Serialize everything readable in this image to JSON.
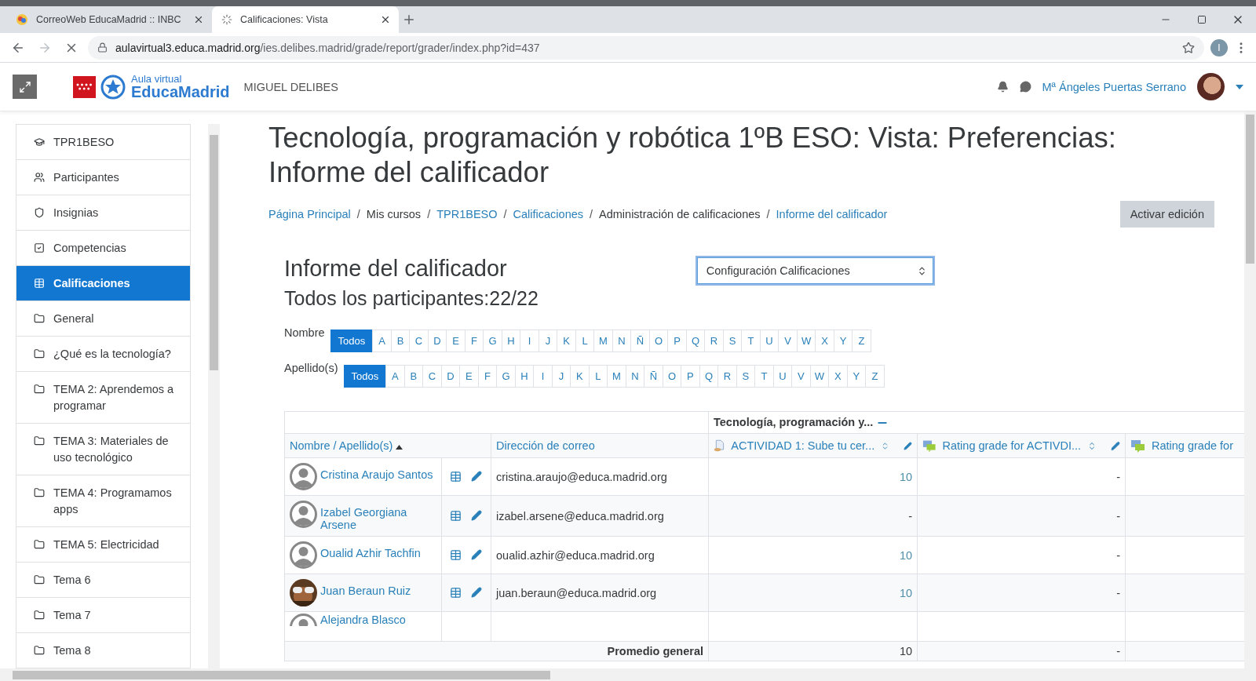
{
  "browser": {
    "tabs": [
      {
        "title": "CorreoWeb EducaMadrid :: INBC",
        "selected": false,
        "loading": false
      },
      {
        "title": "Calificaciones: Vista",
        "selected": true,
        "loading": true
      }
    ],
    "url": {
      "host": "aulavirtual3.educa.madrid.org",
      "path": "/ies.delibes.madrid/grade/report/grader/index.php?id=437"
    },
    "profile_initial": "I"
  },
  "header": {
    "logo": {
      "small": "Aula virtual",
      "big": "EducaMadrid"
    },
    "site_name": "MIGUEL DELIBES",
    "user_name": "Mª Ángeles Puertas Serrano"
  },
  "sidebar": {
    "items": [
      {
        "label": "TPR1BESO",
        "kind": "course",
        "selected": false
      },
      {
        "label": "Participantes",
        "kind": "participants",
        "selected": false
      },
      {
        "label": "Insignias",
        "kind": "badges",
        "selected": false
      },
      {
        "label": "Competencias",
        "kind": "competencies",
        "selected": false
      },
      {
        "label": "Calificaciones",
        "kind": "grades",
        "selected": true
      },
      {
        "label": "General",
        "kind": "section",
        "selected": false
      },
      {
        "label": "¿Qué es la tecnología?",
        "kind": "section",
        "selected": false
      },
      {
        "label": "TEMA 2: Aprendemos a programar",
        "kind": "section",
        "selected": false
      },
      {
        "label": "TEMA 3: Materiales de uso tecnológico",
        "kind": "section",
        "selected": false
      },
      {
        "label": "TEMA 4: Programamos apps",
        "kind": "section",
        "selected": false
      },
      {
        "label": "TEMA 5: Electricidad",
        "kind": "section",
        "selected": false
      },
      {
        "label": "Tema 6",
        "kind": "section",
        "selected": false
      },
      {
        "label": "Tema 7",
        "kind": "section",
        "selected": false
      },
      {
        "label": "Tema 8",
        "kind": "section",
        "selected": false
      }
    ]
  },
  "page": {
    "title": "Tecnología, programación y robótica 1ºB ESO: Vista: Preferencias: Informe del calificador",
    "breadcrumb": [
      {
        "label": "Página Principal",
        "link": true
      },
      {
        "separator": "/",
        "label": "Mis cursos",
        "link": false
      },
      {
        "separator": "/",
        "label": "TPR1BESO",
        "link": true
      },
      {
        "separator": "/",
        "label": "Calificaciones",
        "link": true
      },
      {
        "separator": "/",
        "label": "Administración de calificaciones",
        "link": false
      },
      {
        "separator": "/",
        "label": "Informe del calificador",
        "link": true
      }
    ],
    "edit_button": "Activar edición",
    "report_title": "Informe del calificador",
    "participants": "Todos los participantes:22/22",
    "select": {
      "value": "Configuración Calificaciones"
    },
    "filters": [
      {
        "label": "Nombre",
        "options": [
          {
            "label": "Todos",
            "selected": true
          },
          {
            "label": "A",
            "selected": false
          },
          {
            "label": "B",
            "selected": false
          },
          {
            "label": "C",
            "selected": false
          },
          {
            "label": "D",
            "selected": false
          },
          {
            "label": "E",
            "selected": false
          },
          {
            "label": "F",
            "selected": false
          },
          {
            "label": "G",
            "selected": false
          },
          {
            "label": "H",
            "selected": false
          },
          {
            "label": "I",
            "selected": false
          },
          {
            "label": "J",
            "selected": false
          },
          {
            "label": "K",
            "selected": false
          },
          {
            "label": "L",
            "selected": false
          },
          {
            "label": "M",
            "selected": false
          },
          {
            "label": "N",
            "selected": false
          },
          {
            "label": "Ñ",
            "selected": false
          },
          {
            "label": "O",
            "selected": false
          },
          {
            "label": "P",
            "selected": false
          },
          {
            "label": "Q",
            "selected": false
          },
          {
            "label": "R",
            "selected": false
          },
          {
            "label": "S",
            "selected": false
          },
          {
            "label": "T",
            "selected": false
          },
          {
            "label": "U",
            "selected": false
          },
          {
            "label": "V",
            "selected": false
          },
          {
            "label": "W",
            "selected": false
          },
          {
            "label": "X",
            "selected": false
          },
          {
            "label": "Y",
            "selected": false
          },
          {
            "label": "Z",
            "selected": false
          }
        ]
      },
      {
        "label": "Apellido(s)",
        "options": [
          {
            "label": "Todos",
            "selected": true
          },
          {
            "label": "A",
            "selected": false
          },
          {
            "label": "B",
            "selected": false
          },
          {
            "label": "C",
            "selected": false
          },
          {
            "label": "D",
            "selected": false
          },
          {
            "label": "E",
            "selected": false
          },
          {
            "label": "F",
            "selected": false
          },
          {
            "label": "G",
            "selected": false
          },
          {
            "label": "H",
            "selected": false
          },
          {
            "label": "I",
            "selected": false
          },
          {
            "label": "J",
            "selected": false
          },
          {
            "label": "K",
            "selected": false
          },
          {
            "label": "L",
            "selected": false
          },
          {
            "label": "M",
            "selected": false
          },
          {
            "label": "N",
            "selected": false
          },
          {
            "label": "Ñ",
            "selected": false
          },
          {
            "label": "O",
            "selected": false
          },
          {
            "label": "P",
            "selected": false
          },
          {
            "label": "Q",
            "selected": false
          },
          {
            "label": "R",
            "selected": false
          },
          {
            "label": "S",
            "selected": false
          },
          {
            "label": "T",
            "selected": false
          },
          {
            "label": "U",
            "selected": false
          },
          {
            "label": "V",
            "selected": false
          },
          {
            "label": "W",
            "selected": false
          },
          {
            "label": "X",
            "selected": false
          },
          {
            "label": "Y",
            "selected": false
          },
          {
            "label": "Z",
            "selected": false
          }
        ]
      }
    ],
    "table": {
      "category": "Tecnología, programación y...",
      "columns": {
        "name": "Nombre / Apellido(s)",
        "email": "Dirección de correo",
        "items": [
          {
            "label": "ACTIVIDAD 1: Sube tu cer...",
            "kind": "assignment"
          },
          {
            "label": "Rating grade for ACTIVDI...",
            "kind": "forum"
          },
          {
            "label": "Rating grade for",
            "kind": "forum"
          }
        ]
      },
      "rows": [
        {
          "name": "Cristina Araujo Santos",
          "kind": "default",
          "email": "cristina.araujo@educa.madrid.org",
          "grades": [
            {
              "value": "10",
              "graded": true
            },
            {
              "value": "-",
              "graded": false
            }
          ]
        },
        {
          "name": "Izabel Georgiana Arsene",
          "kind": "default",
          "email": "izabel.arsene@educa.madrid.org",
          "grades": [
            {
              "value": "-",
              "graded": false
            },
            {
              "value": "-",
              "graded": false
            }
          ]
        },
        {
          "name": "Oualid Azhir Tachfin",
          "kind": "default",
          "email": "oualid.azhir@educa.madrid.org",
          "grades": [
            {
              "value": "10",
              "graded": true
            },
            {
              "value": "-",
              "graded": false
            }
          ]
        },
        {
          "name": "Juan Beraun Ruiz",
          "email": "juan.beraun@educa.madrid.org",
          "grades": [
            {
              "value": "10",
              "graded": true
            },
            {
              "value": "-",
              "graded": false
            }
          ]
        },
        {
          "name": "Alejandra Blasco",
          "kind": "default"
        }
      ],
      "average": {
        "label": "Promedio general",
        "grades": [
          "10",
          "-"
        ]
      }
    }
  }
}
